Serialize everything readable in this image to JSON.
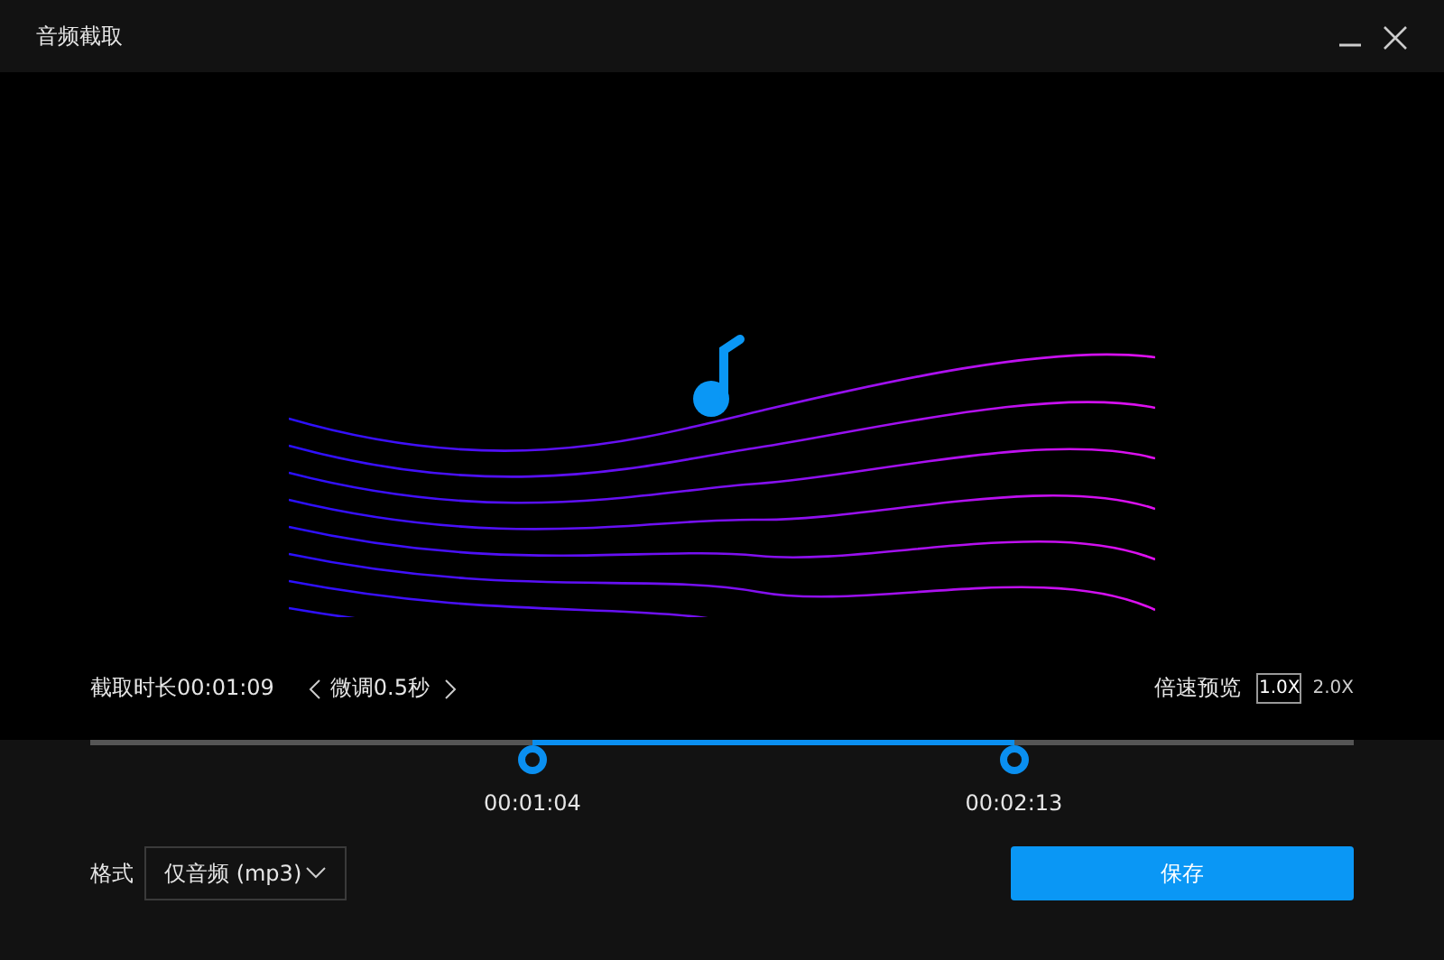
{
  "window": {
    "title": "音频截取"
  },
  "clip": {
    "duration_label": "截取时长00:01:09",
    "fine_tune": "微调0.5秒"
  },
  "speed_preview": {
    "label": "倍速预览",
    "options": [
      {
        "label": "1.0X",
        "selected": true
      },
      {
        "label": "2.0X",
        "selected": false
      }
    ]
  },
  "range": {
    "start": {
      "time": "00:01:04",
      "level": 0.35
    },
    "end": {
      "time": "00:02:13",
      "level": 0.731
    }
  },
  "format": {
    "label": "格式",
    "value": "仅音频 (mp3)"
  },
  "buttons": {
    "save": "保存"
  }
}
